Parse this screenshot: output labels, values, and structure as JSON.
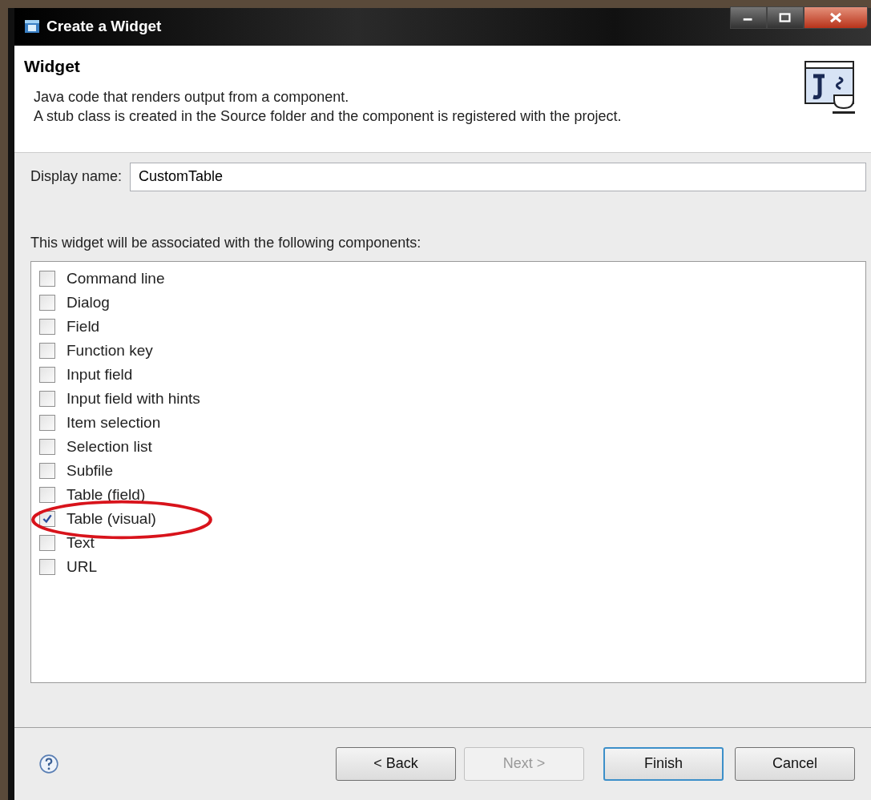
{
  "window": {
    "title": "Create a Widget"
  },
  "header": {
    "title": "Widget",
    "description": [
      "Java code that renders output from a component.",
      "A stub class is created in the Source folder and the component is registered with the project."
    ]
  },
  "display_name": {
    "label": "Display name:",
    "value": "CustomTable"
  },
  "components": {
    "label": "This widget will be associated with the following components:",
    "items": [
      {
        "label": "Command line",
        "checked": false,
        "circled": false
      },
      {
        "label": "Dialog",
        "checked": false,
        "circled": false
      },
      {
        "label": "Field",
        "checked": false,
        "circled": false
      },
      {
        "label": "Function key",
        "checked": false,
        "circled": false
      },
      {
        "label": "Input field",
        "checked": false,
        "circled": false
      },
      {
        "label": "Input field with hints",
        "checked": false,
        "circled": false
      },
      {
        "label": "Item selection",
        "checked": false,
        "circled": false
      },
      {
        "label": "Selection list",
        "checked": false,
        "circled": false
      },
      {
        "label": "Subfile",
        "checked": false,
        "circled": false
      },
      {
        "label": "Table (field)",
        "checked": false,
        "circled": false
      },
      {
        "label": "Table (visual)",
        "checked": true,
        "circled": true
      },
      {
        "label": "Text",
        "checked": false,
        "circled": false
      },
      {
        "label": "URL",
        "checked": false,
        "circled": false
      }
    ]
  },
  "buttons": [
    {
      "label": "< Back",
      "disabled": false,
      "default": false
    },
    {
      "label": "Next >",
      "disabled": true,
      "default": false
    },
    {
      "label": "Finish",
      "disabled": false,
      "default": true
    },
    {
      "label": "Cancel",
      "disabled": false,
      "default": false
    }
  ]
}
